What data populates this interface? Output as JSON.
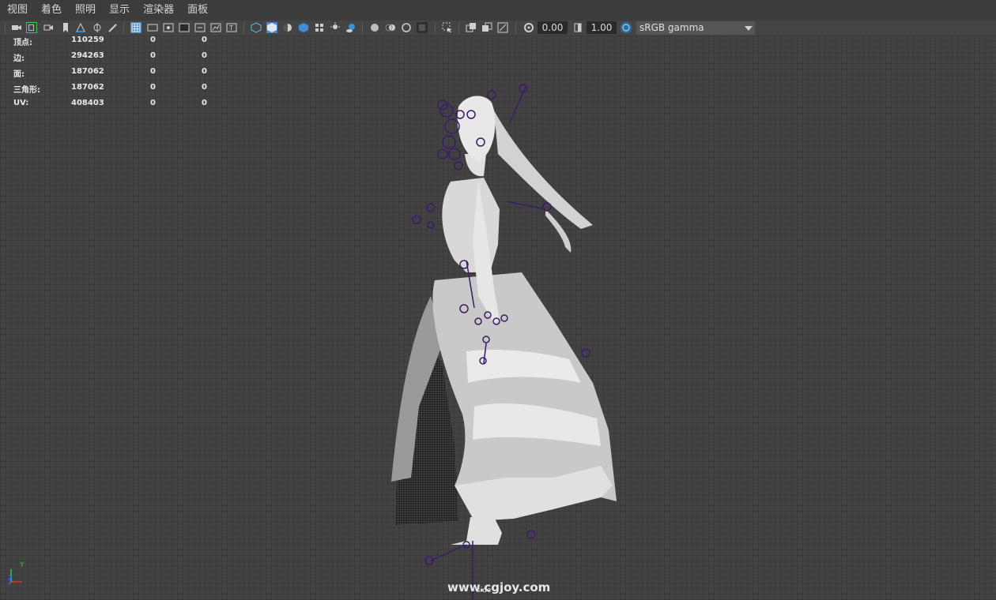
{
  "menu": [
    "视图",
    "着色",
    "照明",
    "显示",
    "渲染器",
    "面板"
  ],
  "toolbar": {
    "exposure": "0.00",
    "gamma": "1.00",
    "colorspace": "sRGB gamma",
    "icons": [
      "select-camera-icon",
      "camera-attributes-icon",
      "bookmark-icon",
      "image-plane-icon",
      "grid-icon",
      "film-gate-icon",
      "resolution-gate-icon",
      "gate-mask-icon",
      "field-chart-icon",
      "safe-action-icon",
      "safe-title-icon",
      "wireframe-icon",
      "smooth-shade-icon",
      "default-material-icon",
      "textured-icon",
      "use-lights-icon",
      "shadows-icon",
      "ambient-occlusion-icon",
      "motion-blur-icon",
      "anti-aliasing-icon",
      "depth-of-field-icon",
      "xray-icon",
      "xray-joints-icon",
      "isolate-select-icon",
      "hud-icon",
      "exposure-icon",
      "gamma-icon",
      "color-management-icon"
    ]
  },
  "hud": {
    "rows": [
      {
        "label": "顶点:",
        "v1": "110259",
        "v2": "0",
        "v3": "0"
      },
      {
        "label": "边:",
        "v1": "294263",
        "v2": "0",
        "v3": "0"
      },
      {
        "label": "面:",
        "v1": "187062",
        "v2": "0",
        "v3": "0"
      },
      {
        "label": "三角形:",
        "v1": "187062",
        "v2": "0",
        "v3": "0"
      },
      {
        "label": "UV:",
        "v1": "408403",
        "v2": "0",
        "v3": "0"
      }
    ]
  },
  "viewport": {
    "camera_label": "side",
    "watermark": "www.cgjoy.com",
    "axis_y": "Y",
    "axis_z": "Z"
  },
  "colors": {
    "menubar": "#3c3c3c",
    "viewport_bg": "#434343",
    "accent": "#3a8fd6",
    "joint": "#3b1b6b"
  }
}
